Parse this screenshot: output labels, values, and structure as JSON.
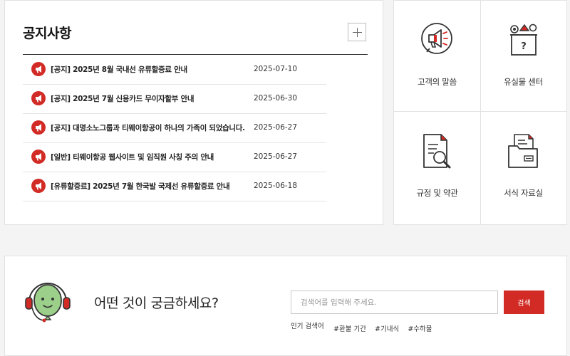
{
  "notice": {
    "title": "공지사항",
    "items": [
      {
        "text": "[공지] 2025년 8월 국내선 유류할증료 안내",
        "date": "2025-07-10"
      },
      {
        "text": "[공지] 2025년 7월 신용카드 무이자할부 안내",
        "date": "2025-06-30"
      },
      {
        "text": "[공지] 대명소노그룹과 티웨이항공이 하나의 가족이 되었습니다.",
        "date": "2025-06-27"
      },
      {
        "text": "[일반] 티웨이항공 웹사이트 및 임직원 사칭 주의 안내",
        "date": "2025-06-27"
      },
      {
        "text": "[유류할증료] 2025년 7월 한국발 국제선 유류할증료 안내",
        "date": "2025-06-18"
      }
    ]
  },
  "services": [
    {
      "label": "고객의 말씀",
      "icon": "megaphone-icon"
    },
    {
      "label": "유실물 센터",
      "icon": "lost-box-icon"
    },
    {
      "label": "규정 및 약관",
      "icon": "document-search-icon"
    },
    {
      "label": "서식 자료실",
      "icon": "folder-icon"
    }
  ],
  "search": {
    "question": "어떤 것이 궁금하세요?",
    "placeholder": "검색어를 입력해 주세요.",
    "button_label": "검색",
    "popular_label": "인기 검색어",
    "tags": [
      "#환불 기간",
      "#기내식",
      "#수하물"
    ]
  },
  "colors": {
    "accent": "#d22b25",
    "agent": "#9ccf8a"
  }
}
